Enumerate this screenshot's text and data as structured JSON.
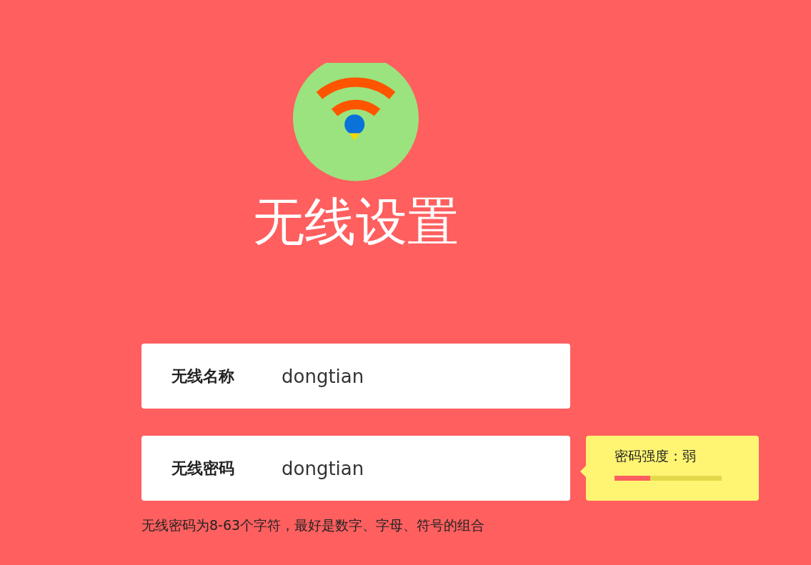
{
  "title": "无线设置",
  "fields": [
    {
      "label": "无线名称",
      "value": "dongtian"
    },
    {
      "label": "无线密码",
      "value": "dongtian"
    }
  ],
  "strength": {
    "label": "密码强度：弱",
    "level": 0.33
  },
  "hint": "无线密码为8-63个字符，最好是数字、字母、符号的组合"
}
